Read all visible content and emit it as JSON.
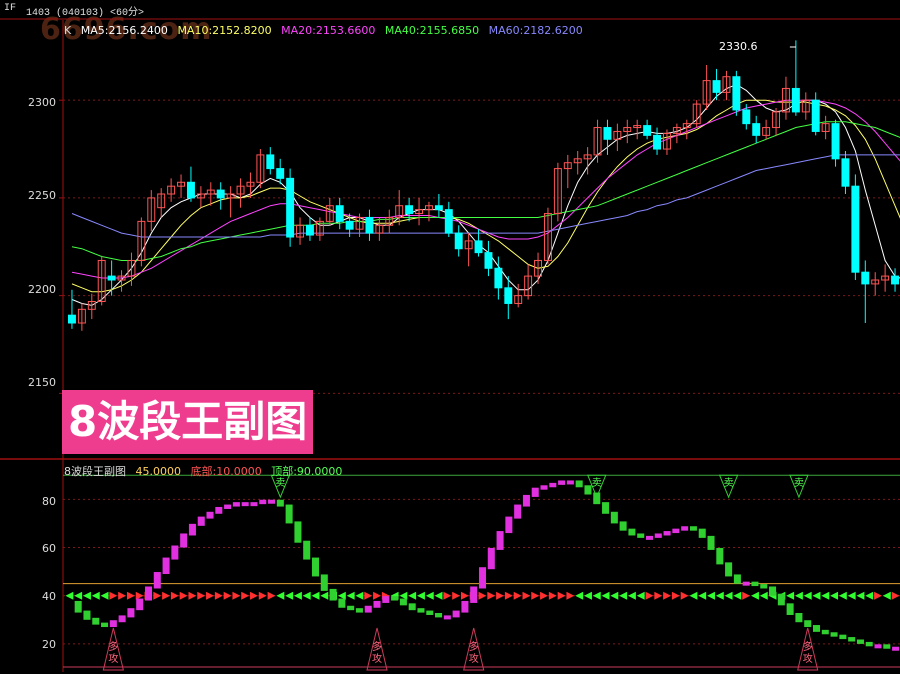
{
  "topbar": {
    "symbol": "IF",
    "contract": "1403 (040103) <60分>"
  },
  "watermark": "6696.com",
  "ma_legend": {
    "k": "K",
    "ma5": "MA5:2156.2400",
    "ma10": "MA10:2152.8200",
    "ma20": "MA20:2153.6600",
    "ma40": "MA40:2155.6850",
    "ma60": "MA60:2182.6200"
  },
  "colors": {
    "ma5": "#ffffff",
    "ma10": "#ffff66",
    "ma20": "#ff44ff",
    "ma40": "#44ff44",
    "ma60": "#8888ff",
    "up": "#ff5555",
    "down": "#00ffff",
    "frame": "#a01010",
    "banner": "#ee3d8f"
  },
  "price_axis": {
    "ticks": [
      "2300",
      "2250",
      "2200",
      "2150"
    ],
    "max_label": "2330.6"
  },
  "banner": {
    "text": "8波段王副图"
  },
  "indicator": {
    "name": "8波段王副图",
    "v45": "45.0000",
    "bottom": "底部:10.0000",
    "top": "顶部:90.0000",
    "ticks": [
      "80",
      "60",
      "40",
      "20"
    ],
    "sell_label": "卖",
    "buy_label": "多攻"
  },
  "chart_data": [
    {
      "type": "candlestick",
      "title": "",
      "y_ticks": [
        2150,
        2200,
        2250,
        2300
      ],
      "ylim": [
        2120,
        2340
      ],
      "grid": true,
      "candles": [
        [
          2190,
          2203,
          2183,
          2186
        ],
        [
          2186,
          2196,
          2182,
          2193
        ],
        [
          2193,
          2201,
          2188,
          2197
        ],
        [
          2197,
          2220,
          2195,
          2218
        ],
        [
          2210,
          2218,
          2200,
          2208
        ],
        [
          2208,
          2213,
          2202,
          2210
        ],
        [
          2210,
          2222,
          2205,
          2218
        ],
        [
          2218,
          2240,
          2215,
          2238
        ],
        [
          2238,
          2254,
          2233,
          2250
        ],
        [
          2245,
          2255,
          2240,
          2252
        ],
        [
          2252,
          2260,
          2248,
          2256
        ],
        [
          2256,
          2262,
          2250,
          2258
        ],
        [
          2258,
          2266,
          2248,
          2250
        ],
        [
          2250,
          2256,
          2245,
          2252
        ],
        [
          2252,
          2258,
          2246,
          2254
        ],
        [
          2254,
          2258,
          2244,
          2250
        ],
        [
          2250,
          2256,
          2240,
          2252
        ],
        [
          2252,
          2260,
          2245,
          2256
        ],
        [
          2256,
          2263,
          2250,
          2258
        ],
        [
          2258,
          2275,
          2255,
          2272
        ],
        [
          2272,
          2276,
          2262,
          2265
        ],
        [
          2265,
          2270,
          2257,
          2260
        ],
        [
          2260,
          2265,
          2225,
          2230
        ],
        [
          2230,
          2240,
          2226,
          2236
        ],
        [
          2236,
          2240,
          2228,
          2231
        ],
        [
          2231,
          2240,
          2228,
          2238
        ],
        [
          2238,
          2250,
          2236,
          2246
        ],
        [
          2246,
          2250,
          2234,
          2238
        ],
        [
          2238,
          2242,
          2230,
          2234
        ],
        [
          2234,
          2242,
          2230,
          2240
        ],
        [
          2240,
          2244,
          2228,
          2232
        ],
        [
          2232,
          2240,
          2228,
          2236
        ],
        [
          2236,
          2244,
          2232,
          2240
        ],
        [
          2240,
          2254,
          2236,
          2246
        ],
        [
          2246,
          2250,
          2238,
          2242
        ],
        [
          2242,
          2250,
          2236,
          2244
        ],
        [
          2244,
          2248,
          2238,
          2246
        ],
        [
          2246,
          2252,
          2240,
          2244
        ],
        [
          2244,
          2248,
          2230,
          2232
        ],
        [
          2232,
          2236,
          2220,
          2224
        ],
        [
          2224,
          2232,
          2215,
          2228
        ],
        [
          2228,
          2234,
          2220,
          2222
        ],
        [
          2222,
          2228,
          2210,
          2214
        ],
        [
          2214,
          2220,
          2198,
          2204
        ],
        [
          2204,
          2210,
          2188,
          2196
        ],
        [
          2196,
          2206,
          2194,
          2200
        ],
        [
          2200,
          2216,
          2198,
          2210
        ],
        [
          2210,
          2222,
          2206,
          2218
        ],
        [
          2218,
          2245,
          2216,
          2242
        ],
        [
          2242,
          2268,
          2238,
          2265
        ],
        [
          2265,
          2272,
          2255,
          2268
        ],
        [
          2268,
          2274,
          2262,
          2270
        ],
        [
          2270,
          2276,
          2262,
          2272
        ],
        [
          2272,
          2290,
          2268,
          2286
        ],
        [
          2286,
          2290,
          2272,
          2280
        ],
        [
          2280,
          2288,
          2274,
          2284
        ],
        [
          2284,
          2290,
          2278,
          2286
        ],
        [
          2286,
          2290,
          2280,
          2287
        ],
        [
          2287,
          2290,
          2280,
          2282
        ],
        [
          2282,
          2286,
          2272,
          2275
        ],
        [
          2275,
          2285,
          2272,
          2283
        ],
        [
          2283,
          2288,
          2278,
          2286
        ],
        [
          2286,
          2290,
          2280,
          2288
        ],
        [
          2288,
          2300,
          2286,
          2298
        ],
        [
          2298,
          2318,
          2295,
          2310
        ],
        [
          2310,
          2316,
          2300,
          2304
        ],
        [
          2304,
          2315,
          2300,
          2312
        ],
        [
          2312,
          2315,
          2292,
          2295
        ],
        [
          2295,
          2298,
          2285,
          2288
        ],
        [
          2288,
          2292,
          2278,
          2282
        ],
        [
          2282,
          2290,
          2280,
          2286
        ],
        [
          2286,
          2296,
          2282,
          2294
        ],
        [
          2294,
          2312,
          2290,
          2306
        ],
        [
          2306,
          2330.6,
          2292,
          2294
        ],
        [
          2294,
          2304,
          2290,
          2300
        ],
        [
          2300,
          2304,
          2282,
          2284
        ],
        [
          2284,
          2292,
          2280,
          2288
        ],
        [
          2288,
          2290,
          2266,
          2270
        ],
        [
          2270,
          2274,
          2252,
          2256
        ],
        [
          2256,
          2262,
          2208,
          2212
        ],
        [
          2212,
          2218,
          2186,
          2206
        ],
        [
          2206,
          2212,
          2200,
          2208
        ],
        [
          2208,
          2216,
          2202,
          2210
        ],
        [
          2210,
          2214,
          2202,
          2206
        ]
      ],
      "ma": {
        "MA5": [
          2198,
          2196,
          2195,
          2198,
          2203,
          2208,
          2214,
          2222,
          2232,
          2240,
          2245,
          2248,
          2250,
          2252,
          2252,
          2252,
          2252,
          2250,
          2252,
          2257,
          2260,
          2258,
          2253,
          2245,
          2240,
          2236,
          2236,
          2238,
          2240,
          2240,
          2238,
          2236,
          2236,
          2240,
          2242,
          2244,
          2244,
          2244,
          2242,
          2238,
          2232,
          2226,
          2222,
          2215,
          2208,
          2203,
          2203,
          2208,
          2218,
          2232,
          2246,
          2258,
          2266,
          2272,
          2276,
          2280,
          2282,
          2283,
          2284,
          2283,
          2283,
          2284,
          2286,
          2290,
          2296,
          2302,
          2306,
          2308,
          2305,
          2300,
          2296,
          2294,
          2295,
          2298,
          2300,
          2300,
          2298,
          2294,
          2286,
          2274,
          2254,
          2236,
          2218,
          2210,
          2208
        ],
        "MA10": [
          2206,
          2204,
          2202,
          2202,
          2203,
          2205,
          2208,
          2212,
          2218,
          2224,
          2230,
          2236,
          2241,
          2245,
          2247,
          2249,
          2250,
          2250,
          2251,
          2253,
          2255,
          2255,
          2254,
          2251,
          2248,
          2246,
          2244,
          2242,
          2240,
          2238,
          2237,
          2237,
          2237,
          2238,
          2239,
          2240,
          2240,
          2240,
          2240,
          2239,
          2237,
          2234,
          2231,
          2228,
          2224,
          2220,
          2216,
          2214,
          2215,
          2220,
          2227,
          2236,
          2245,
          2253,
          2260,
          2266,
          2271,
          2275,
          2278,
          2280,
          2281,
          2282,
          2283,
          2285,
          2288,
          2292,
          2295,
          2298,
          2300,
          2300,
          2300,
          2299,
          2299,
          2299,
          2299,
          2298,
          2297,
          2295,
          2292,
          2287,
          2280,
          2270,
          2258,
          2246,
          2234
        ],
        "MA20": [
          2212,
          2211,
          2210,
          2209,
          2209,
          2209,
          2210,
          2212,
          2214,
          2217,
          2220,
          2223,
          2226,
          2229,
          2232,
          2235,
          2238,
          2240,
          2242,
          2244,
          2246,
          2247,
          2247,
          2246,
          2245,
          2244,
          2243,
          2242,
          2241,
          2240,
          2240,
          2240,
          2240,
          2241,
          2241,
          2241,
          2241,
          2240,
          2239,
          2238,
          2236,
          2234,
          2232,
          2230,
          2229,
          2229,
          2229,
          2230,
          2232,
          2236,
          2240,
          2245,
          2250,
          2255,
          2260,
          2264,
          2268,
          2272,
          2275,
          2278,
          2280,
          2282,
          2284,
          2286,
          2288,
          2290,
          2292,
          2294,
          2296,
          2297,
          2298,
          2299,
          2300,
          2300,
          2300,
          2300,
          2299,
          2298,
          2296,
          2293,
          2289,
          2284,
          2278,
          2272,
          2266
        ],
        "MA40": [
          2225,
          2224,
          2222,
          2220,
          2219,
          2218,
          2218,
          2218,
          2219,
          2220,
          2222,
          2224,
          2225,
          2227,
          2228,
          2229,
          2230,
          2231,
          2232,
          2233,
          2234,
          2235,
          2236,
          2236,
          2236,
          2237,
          2237,
          2237,
          2238,
          2238,
          2238,
          2239,
          2239,
          2240,
          2240,
          2240,
          2240,
          2240,
          2240,
          2240,
          2240,
          2240,
          2240,
          2240,
          2240,
          2240,
          2240,
          2240,
          2241,
          2242,
          2243,
          2244,
          2245,
          2246,
          2248,
          2250,
          2252,
          2254,
          2256,
          2258,
          2260,
          2262,
          2264,
          2266,
          2268,
          2270,
          2272,
          2274,
          2276,
          2278,
          2280,
          2282,
          2284,
          2286,
          2287,
          2288,
          2289,
          2289,
          2289,
          2288,
          2287,
          2286,
          2284,
          2282,
          2280
        ],
        "MA60": [
          2242,
          2240,
          2238,
          2236,
          2234,
          2232,
          2231,
          2230,
          2230,
          2230,
          2230,
          2230,
          2230,
          2230,
          2230,
          2230,
          2230,
          2230,
          2230,
          2230,
          2231,
          2231,
          2231,
          2232,
          2232,
          2232,
          2232,
          2232,
          2232,
          2232,
          2232,
          2232,
          2232,
          2232,
          2232,
          2232,
          2232,
          2232,
          2232,
          2232,
          2232,
          2232,
          2232,
          2232,
          2232,
          2232,
          2232,
          2232,
          2233,
          2234,
          2235,
          2236,
          2237,
          2238,
          2239,
          2240,
          2241,
          2243,
          2244,
          2246,
          2247,
          2249,
          2250,
          2252,
          2254,
          2256,
          2258,
          2260,
          2262,
          2264,
          2265,
          2266,
          2267,
          2268,
          2269,
          2270,
          2271,
          2272,
          2272,
          2272,
          2272,
          2272,
          2272,
          2272,
          2272
        ]
      }
    },
    {
      "type": "bar",
      "title": "8波段王副图",
      "y_ticks": [
        20,
        40,
        60,
        80
      ],
      "ylim": [
        10,
        93
      ],
      "reference_lines": {
        "v45": 45,
        "bottom": 10,
        "top": 90
      },
      "values": [
        37,
        33,
        30,
        28,
        27,
        29,
        31,
        34,
        38,
        43,
        49,
        55,
        60,
        65,
        69,
        72,
        74,
        76,
        77,
        78,
        78,
        78,
        79,
        79,
        77,
        70,
        62,
        55,
        48,
        42,
        38,
        35,
        34,
        33,
        35,
        37,
        39,
        38,
        36,
        34,
        33,
        32,
        31,
        31,
        33,
        37,
        43,
        51,
        59,
        66,
        72,
        77,
        81,
        84,
        85,
        86,
        87,
        87,
        85,
        82,
        78,
        74,
        70,
        67,
        65,
        64,
        64,
        65,
        66,
        67,
        68,
        67,
        64,
        59,
        53,
        48,
        45,
        45,
        44,
        43,
        40,
        36,
        32,
        29,
        27,
        25,
        24,
        23,
        22,
        21,
        20,
        19,
        19,
        18,
        18
      ],
      "signal_strip": {
        "y": 40,
        "up_color": "#ff3030",
        "down_color": "#30ff30"
      },
      "sell_markers_at": [
        24,
        60,
        75,
        83
      ],
      "buy_markers_at": [
        5,
        35,
        46,
        84
      ]
    }
  ]
}
